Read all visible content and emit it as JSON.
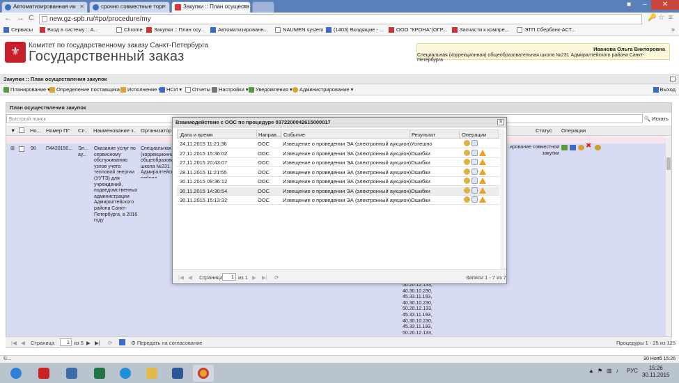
{
  "browser": {
    "tabs": [
      {
        "label": "Автоматизированная ин"
      },
      {
        "label": "срочно совместные торг"
      },
      {
        "label": "Закупки :: План осуществ"
      }
    ],
    "url": "new.gz-spb.ru/#po/procedure/my",
    "bookmarks": [
      {
        "label": "Сервисы"
      },
      {
        "label": "Вход в систему :: А..."
      },
      {
        "label": "Chrome"
      },
      {
        "label": "Закупки :: План осу..."
      },
      {
        "label": "Автоматизированн..."
      },
      {
        "label": "NAUMEN system"
      },
      {
        "label": "(1403) Входящие - ..."
      },
      {
        "label": "ООО \"КРОНА\"(ОГР..."
      },
      {
        "label": "Запчасти к компре..."
      },
      {
        "label": "ЭТП Сбербанк-АСТ..."
      }
    ],
    "bookmarks_more": "»"
  },
  "header": {
    "org_small": "Комитет по государственному заказу Санкт-Петербурга",
    "org_big": "Государственный заказ",
    "user_name": "Иванова Ольга Викторовна",
    "user_org": "Специальная (коррекционная) общеобразовательная школа №231 Адмиралтейского района Санкт-Петербурга"
  },
  "page_title": "Закупки :: План осуществления закупок",
  "menu": [
    {
      "label": "Планирование"
    },
    {
      "label": "Определение поставщика"
    },
    {
      "label": "Исполнение"
    },
    {
      "label": "НСИ"
    },
    {
      "label": "Отчеты"
    },
    {
      "label": "Настройки"
    },
    {
      "label": "Уведомления"
    },
    {
      "label": "Администрирование"
    }
  ],
  "logout_label": "Выход",
  "panel": {
    "title": "План осуществления закупок",
    "search_placeholder": "Быстрый поиск",
    "search_button": "Искать",
    "columns": [
      "Но...",
      "Номер ПГ",
      "Сп...",
      "Наименование з...",
      "Организатор",
      "Статус",
      "Операции"
    ],
    "row": {
      "num": "90",
      "pg": "П4420150...",
      "sp": "Эл... ау...",
      "name": "Оказание услуг по сервисному обслуживанию узлов учета тепловой энергии (УУТЭ) для учреждений, подведомственных администрации Адмиралтейского района Санкт-Петербурга, в 2016 году",
      "organizer": "Специальная (коррекционная) общеобразова... школа №231 Адмиралтейского района Санкт-Петербурга",
      "status": "...ирование совместной закупки",
      "codes": "50.20.12.133, 40.30.10.230, 45.33.11.193, 40.30.10.230, 50.20.12.133, 45.33.11.193, 40.30.10.230, 45.33.11.193, 50.20.12.133, 40.30.10.230, 40.30.10.230"
    },
    "pager": {
      "page_label": "Страница",
      "page_value": "1",
      "of_label": "из 5",
      "approve_label": "Передать на согласование",
      "records_label": "Процедуры 1 - 25 из 125"
    }
  },
  "modal": {
    "title": "Взаимодействие с ООС по процедуре 0372200042615000017",
    "columns": [
      "Дата и время",
      "Направ...",
      "Событие",
      "Результат",
      "Операции"
    ],
    "rows": [
      {
        "dt": "24.11.2015 11:21:36",
        "dir": "ООС",
        "event": "Извещение о проведении ЭА (электронный аукцион)",
        "result": "Успешно",
        "warn": false,
        "hl": false
      },
      {
        "dt": "27.11.2015 15:36:02",
        "dir": "ООС",
        "event": "Извещение о проведении ЭА (электронный аукцион)",
        "result": "Ошибки",
        "warn": true,
        "hl": false
      },
      {
        "dt": "27.11.2015 20:43:07",
        "dir": "ООС",
        "event": "Извещение о проведении ЭА (электронный аукцион)",
        "result": "Ошибки",
        "warn": true,
        "hl": false
      },
      {
        "dt": "28.11.2015 11:21:55",
        "dir": "ООС",
        "event": "Извещение о проведении ЭА (электронный аукцион)",
        "result": "Ошибки",
        "warn": true,
        "hl": false
      },
      {
        "dt": "30.11.2015 09:36:12",
        "dir": "ООС",
        "event": "Извещение о проведении ЭА (электронный аукцион)",
        "result": "Ошибки",
        "warn": true,
        "hl": false
      },
      {
        "dt": "30.11.2015 14:30:54",
        "dir": "ООС",
        "event": "Извещение о проведении ЭА (электронный аукцион)",
        "result": "Ошибки",
        "warn": true,
        "hl": true
      },
      {
        "dt": "30.11.2015 15:13:32",
        "dir": "ООС",
        "event": "Извещение о проведении ЭА (электронный аукцион)",
        "result": "Ошибки",
        "warn": true,
        "hl": false
      }
    ],
    "pager": {
      "page_label": "Страница",
      "page_value": "1",
      "of_label": "из 1",
      "records_label": "Записи 1 - 7 из 7"
    }
  },
  "statusbar": {
    "left": "©...",
    "right": "30 Нояб 15:26"
  },
  "taskbar": {
    "lang": "РУС",
    "time": "15:26",
    "date": "30.11.2015"
  },
  "colors": {
    "row_bg": "#d7dcf4",
    "pink_row": "#f7e3e9",
    "accent_red": "#c8202a",
    "tab_strip": "#5b7fb8"
  }
}
